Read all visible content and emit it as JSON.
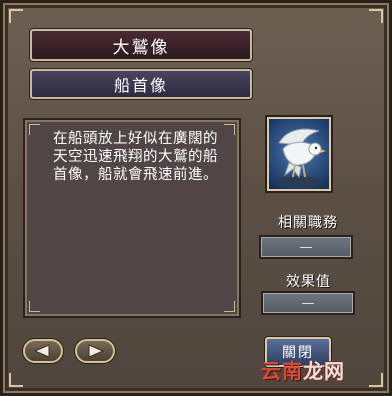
{
  "window": {
    "title": "大鷲像",
    "item_name": "船首像"
  },
  "description": "在船頭放上好似在廣闊的天空迅速飛翔的大鷲的船首像，船就會飛速前進。",
  "portrait": {
    "icon": "eagle-figurehead-icon"
  },
  "stats": {
    "related_job_label": "相關職務",
    "related_job_value": "—",
    "effect_label": "效果值",
    "effect_value": "—"
  },
  "buttons": {
    "prev_icon": "arrow-left-icon",
    "next_icon": "arrow-right-icon",
    "close_label": "關閉"
  },
  "watermark": {
    "part1": "云南",
    "part2": "龙网"
  },
  "colors": {
    "title_bg": "#2b1a1f",
    "subtitle_bg": "#2d2a3e",
    "panel_bg": "#4f4645",
    "frame_bg": "#5d5146",
    "close_bg": "#2f3f62"
  }
}
